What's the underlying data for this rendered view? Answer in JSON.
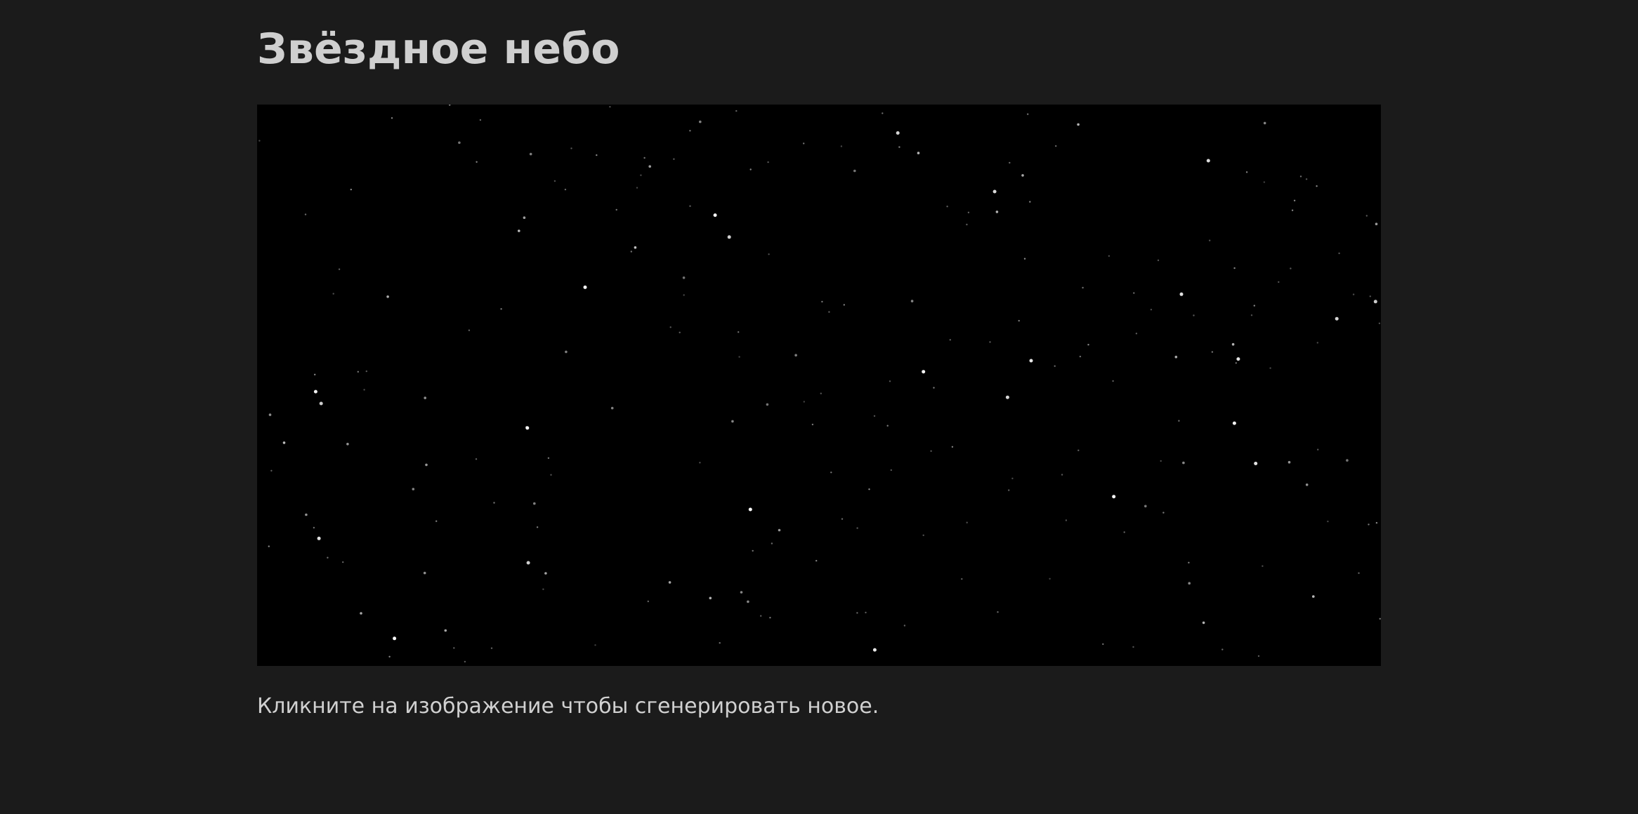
{
  "page": {
    "title": "Звёздное небо",
    "hint": "Кликните на изображение чтобы сгенерировать новое."
  },
  "sky": {
    "background_color": "#000000",
    "star_color": "#ffffff"
  }
}
